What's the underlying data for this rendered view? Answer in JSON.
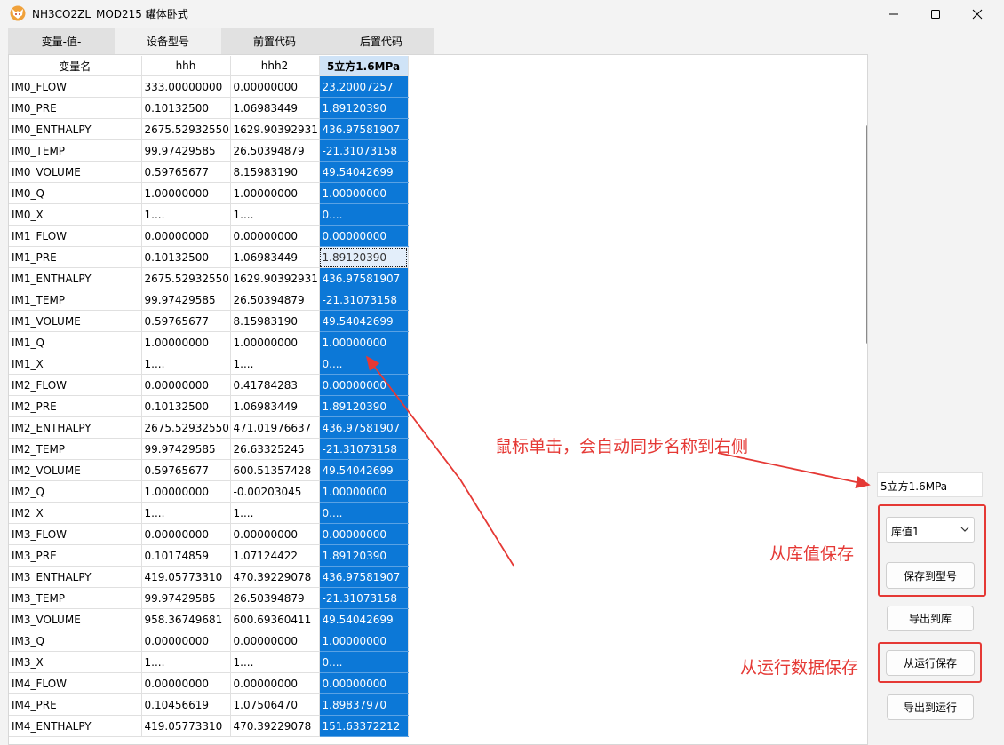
{
  "window": {
    "title": "NH3CO2ZL_MOD215 罐体卧式"
  },
  "tabs": [
    {
      "label": "变量-值-"
    },
    {
      "label": "设备型号"
    },
    {
      "label": "前置代码"
    },
    {
      "label": "后置代码"
    }
  ],
  "table": {
    "columns": [
      "变量名",
      "hhh",
      "hhh2",
      "5立方1.6MPa"
    ],
    "rows": [
      [
        "IM0_FLOW",
        "333.00000000",
        "0.00000000",
        "23.20007257"
      ],
      [
        "IM0_PRE",
        "0.10132500",
        "1.06983449",
        "1.89120390"
      ],
      [
        "IM0_ENTHALPY",
        "2675.52932550",
        "1629.90392931",
        "436.97581907"
      ],
      [
        "IM0_TEMP",
        "99.97429585",
        "26.50394879",
        "-21.31073158"
      ],
      [
        "IM0_VOLUME",
        "0.59765677",
        "8.15983190",
        "49.54042699"
      ],
      [
        "IM0_Q",
        "1.00000000",
        "1.00000000",
        "1.00000000"
      ],
      [
        "IM0_X",
        "1....",
        "1....",
        "0...."
      ],
      [
        "IM1_FLOW",
        "0.00000000",
        "0.00000000",
        "0.00000000"
      ],
      [
        "IM1_PRE",
        "0.10132500",
        "1.06983449",
        "1.89120390"
      ],
      [
        "IM1_ENTHALPY",
        "2675.52932550",
        "1629.90392931",
        "436.97581907"
      ],
      [
        "IM1_TEMP",
        "99.97429585",
        "26.50394879",
        "-21.31073158"
      ],
      [
        "IM1_VOLUME",
        "0.59765677",
        "8.15983190",
        "49.54042699"
      ],
      [
        "IM1_Q",
        "1.00000000",
        "1.00000000",
        "1.00000000"
      ],
      [
        "IM1_X",
        "1....",
        "1....",
        "0...."
      ],
      [
        "IM2_FLOW",
        "0.00000000",
        "0.41784283",
        "0.00000000"
      ],
      [
        "IM2_PRE",
        "0.10132500",
        "1.06983449",
        "1.89120390"
      ],
      [
        "IM2_ENTHALPY",
        "2675.52932550",
        "471.01976637",
        "436.97581907"
      ],
      [
        "IM2_TEMP",
        "99.97429585",
        "26.63325245",
        "-21.31073158"
      ],
      [
        "IM2_VOLUME",
        "0.59765677",
        "600.51357428",
        "49.54042699"
      ],
      [
        "IM2_Q",
        "1.00000000",
        "-0.00203045",
        "1.00000000"
      ],
      [
        "IM2_X",
        "1....",
        "1....",
        "0...."
      ],
      [
        "IM3_FLOW",
        "0.00000000",
        "0.00000000",
        "0.00000000"
      ],
      [
        "IM3_PRE",
        "0.10174859",
        "1.07124422",
        "1.89120390"
      ],
      [
        "IM3_ENTHALPY",
        "419.05773310",
        "470.39229078",
        "436.97581907"
      ],
      [
        "IM3_TEMP",
        "99.97429585",
        "26.50394879",
        "-21.31073158"
      ],
      [
        "IM3_VOLUME",
        "958.36749681",
        "600.69360411",
        "49.54042699"
      ],
      [
        "IM3_Q",
        "0.00000000",
        "0.00000000",
        "1.00000000"
      ],
      [
        "IM3_X",
        "1....",
        "1....",
        "0...."
      ],
      [
        "IM4_FLOW",
        "0.00000000",
        "0.00000000",
        "0.00000000"
      ],
      [
        "IM4_PRE",
        "0.10456619",
        "1.07506470",
        "1.89837970"
      ],
      [
        "IM4_ENTHALPY",
        "419.05773310",
        "470.39229078",
        "151.63372212"
      ]
    ]
  },
  "side_panel": {
    "name_value": "5立方1.6MPa",
    "library_select": "库值1",
    "save_to_model": "保存到型号",
    "export_to_library": "导出到库",
    "save_from_run": "从运行保存",
    "export_to_run": "导出到运行"
  },
  "annotations": {
    "click_sync": "鼠标单击，会自动同步名称到右侧",
    "save_from_library": "从库值保存",
    "save_from_run_data": "从运行数据保存"
  },
  "colors": {
    "selection": "#0c78d7",
    "annotation": "#e53935"
  },
  "icons": {
    "app": "fox-logo-icon",
    "minimize": "minimize-icon",
    "maximize": "maximize-icon",
    "close": "close-icon",
    "dropdown": "chevron-down-icon"
  }
}
